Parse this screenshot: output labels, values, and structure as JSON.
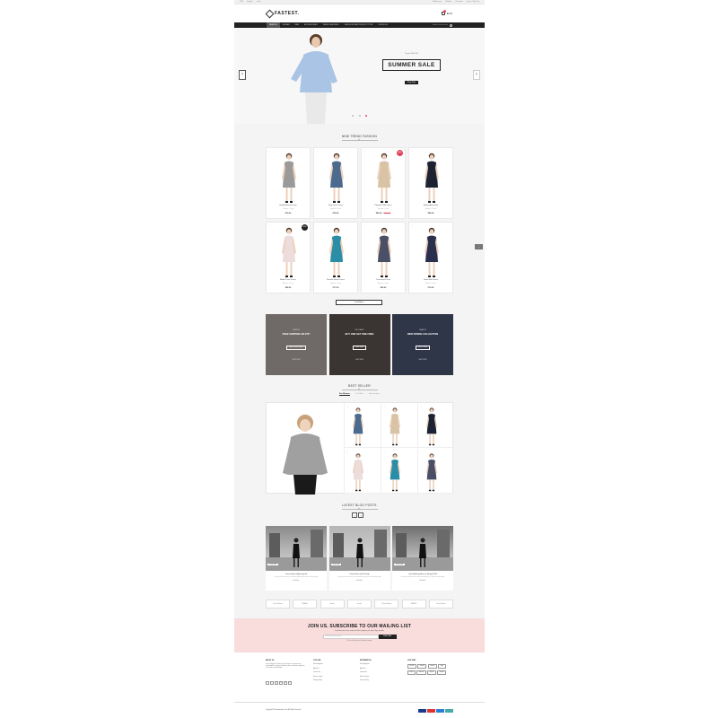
{
  "topbar": {
    "left": [
      "USD",
      "English",
      "Links"
    ],
    "right": [
      "My Account",
      "Wishlist",
      "Checkout",
      "Log In / Sign Up"
    ]
  },
  "header": {
    "logo": "FASTEST.",
    "cart_count": "0",
    "cart_total": "$0.00"
  },
  "nav": {
    "items": [
      "Fashion",
      "Women",
      "Men",
      "Accessories",
      "Trend Features",
      "Category and Product Type",
      "Our Blog"
    ],
    "search_placeholder": "Search entire store"
  },
  "hero": {
    "kicker": "Up to 70% Off",
    "title": "SUMMER SALE",
    "button": "Shop Now",
    "prev": "‹",
    "next": "›"
  },
  "trend": {
    "title": "New Trend Fashion",
    "load_more": "Load More",
    "products": [
      {
        "name": "Embellished Jersey",
        "category": "Women - Tops",
        "price": "$75.00",
        "old_price": "",
        "badge": "",
        "color": "#9a9a9a"
      },
      {
        "name": "Grey Lace Dress",
        "category": "Women - Dress",
        "price": "$78.00",
        "old_price": "",
        "badge": "",
        "color": "#4b6a8e"
      },
      {
        "name": "Pleated Tulle Dress",
        "category": "Women - Dress",
        "price": "$85.00",
        "old_price": "$115.00",
        "badge": "SALE",
        "color": "#d9c3a5"
      },
      {
        "name": "Embroidery Skirt",
        "category": "Women - Dress",
        "price": "$89.00",
        "old_price": "",
        "badge": "",
        "color": "#1d2233"
      },
      {
        "name": "Bridal Tunic Dress",
        "category": "Women - Dress",
        "price": "$88.00",
        "old_price": "",
        "badge": "NEW",
        "color": "#ecdcdc"
      },
      {
        "name": "Printed Skater Dress",
        "category": "Women - Dress",
        "price": "$77.00",
        "old_price": "",
        "badge": "",
        "color": "#2b8ea6"
      },
      {
        "name": "Oversized Dress",
        "category": "Women - Dress",
        "price": "$95.00",
        "old_price": "",
        "badge": "",
        "color": "#4a4f66"
      },
      {
        "name": "Satin Mini Dress",
        "category": "Women - Dress",
        "price": "$76.00",
        "old_price": "",
        "badge": "",
        "color": "#2a2f4d"
      }
    ]
  },
  "banners": [
    {
      "kicker": "FASHION",
      "title": "FREE SHIPPING ON $75*",
      "button": "SHOP NOW ORDER",
      "more": "SHOP NOW",
      "bg": "#6f6a68"
    },
    {
      "kicker": "THE CLASSIC",
      "title": "BUY ONE GET ONE FREE",
      "button": "SHOP NOW",
      "more": "SHOP NOW",
      "bg": "#3a3432"
    },
    {
      "kicker": "FASHION",
      "title": "NEW SPRING COLLECTION",
      "button": "BUY IT NOW",
      "more": "SHOP NOW",
      "bg": "#2f3647"
    }
  ],
  "bestseller": {
    "title": "Best Seller",
    "tabs": [
      "For Women",
      "For Men",
      "Accessories"
    ],
    "items": [
      {
        "color": "#4b6a8e"
      },
      {
        "color": "#d9c3a5"
      },
      {
        "color": "#1d2233"
      },
      {
        "color": "#ecdcdc"
      },
      {
        "color": "#2b8ea6"
      },
      {
        "color": "#4a4f66"
      }
    ]
  },
  "blog": {
    "title": "Latest Blog Posts",
    "prev": "‹",
    "next": "›",
    "posts": [
      {
        "date": "25 Dec 2016",
        "title": "Consectetur adipiscing elit",
        "excerpt": "Lorem ipsum dolor sit amet, consectetur adipiscing elit, sed do eiusmod tempor",
        "more": "Read More"
      },
      {
        "date": "25 Dec 2016",
        "title": "Party Times with Family",
        "excerpt": "Lorem ipsum dolor sit amet, consectetur adipiscing elit, sed do eiusmod tempor",
        "more": "Read More"
      },
      {
        "date": "25 Dec 2016",
        "title": "City Guide gardens in Spring 2016",
        "excerpt": "Lorem ipsum dolor sit amet, consectetur adipiscing elit, sed do eiusmod tempor",
        "more": "Read More"
      }
    ]
  },
  "brands": [
    "Brand Name",
    "BRAND",
    "Brand",
    "Brand",
    "Brand Name",
    "BRAND",
    "Brand Name"
  ],
  "newsletter": {
    "title": "JOIN US. SUBSCRIBE TO OUR MAILING LIST",
    "subtitle": "Get all the latest news, trends and offers straight to your inbox. Sign up today!",
    "placeholder": "Enter your email address",
    "button": "SUBSCRIBE",
    "note": "*Offer for all first orders. Unsubscribe anytime."
  },
  "footer": {
    "about_title": "About Us",
    "about_text": "Fastest Magento 2 theme has clean layout, responsive and customizable. Lorem ipsum dolor sit amet, consectetur adipiscing elit, sed do eiusmod tempor.",
    "socials": [
      "f",
      "t",
      "g",
      "in",
      "p",
      "v"
    ],
    "col2_title": "You Like",
    "col2_links": [
      "Site Navigation",
      "About Us",
      "Contact Us",
      "Store Location",
      "Privacy Policy"
    ],
    "col3_title": "Information",
    "col3_links": [
      "Site Navigation",
      "About Us",
      "Contact Us",
      "Store Location",
      "Privacy Policy"
    ],
    "col4_title": "Our Tags",
    "tags": [
      "Fashion",
      "Jewelry",
      "For Men",
      "Bags",
      "Shoes",
      "Dresses",
      "Jackets",
      "Women"
    ],
    "copyright": "Copyright 2016 www.website.com | All Rights Reserved",
    "payments": [
      "#1a3a8a",
      "#d33",
      "#2a7fd4",
      "#4aa"
    ]
  }
}
